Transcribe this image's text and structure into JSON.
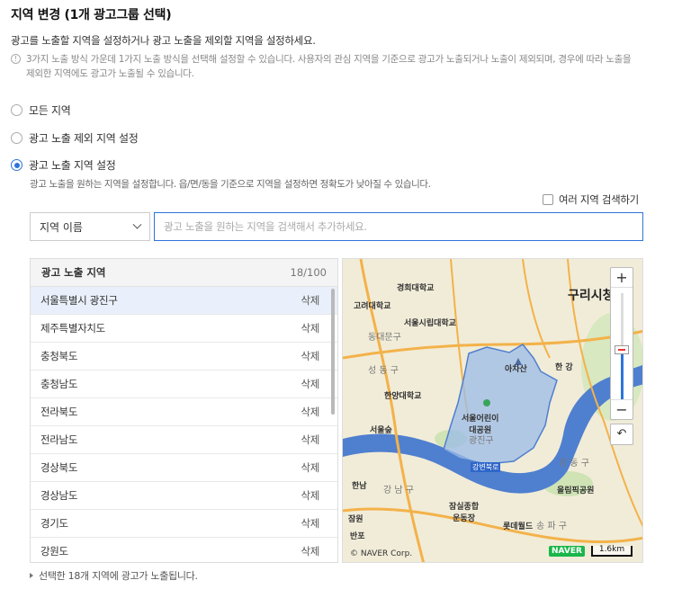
{
  "header": {
    "title": "지역 변경 (1개 광고그룹 선택)",
    "description": "광고를 노출할 지역을 설정하거나 광고 노출을 제외할 지역을 설정하세요.",
    "note_icon": "info-icon",
    "note": "3가지 노출 방식 가운데 1가지 노출 방식을 선택해 설정할 수 있습니다. 사용자의 관심 지역을 기준으로 광고가 노출되거나 노출이 제외되며, 경우에 따라 노출을 제외한 지역에도 광고가 노출될 수 있습니다."
  },
  "options": [
    {
      "label": "모든 지역",
      "selected": false
    },
    {
      "label": "광고 노출 제외 지역 설정",
      "selected": false
    },
    {
      "label": "광고 노출 지역 설정",
      "selected": true
    }
  ],
  "option_desc": "광고 노출을 원하는 지역을 설정합니다. 읍/면/동을 기준으로 지역을 설정하면 정확도가 낮아질 수 있습니다.",
  "multi_search": {
    "label": "여러 지역 검색하기",
    "checked": false
  },
  "search": {
    "type_value": "지역 이름",
    "placeholder": "광고 노출을 원하는 지역을 검색해서 추가하세요."
  },
  "region_list": {
    "header": "광고 노출 지역",
    "count": "18/100",
    "delete_label": "삭제",
    "items": [
      "서울특별시 광진구",
      "제주특별자치도",
      "충청북도",
      "충청남도",
      "전라북도",
      "전라남도",
      "경상북도",
      "경상남도",
      "경기도",
      "강원도"
    ]
  },
  "footer": "선택한 18개 지역에 광고가 노출됩니다.",
  "map": {
    "copyright": "© NAVER Corp.",
    "brand": "NAVER",
    "scale": "1.6km",
    "zoom_in": "+",
    "zoom_out": "−",
    "reset_icon": "undo-icon",
    "labels": {
      "guri": "구리시청",
      "hangang": "한 강",
      "gwangjin": "광진구",
      "children_park": "서울어린이\n대공원",
      "achasan": "아차산",
      "seongdong": "성 동 구",
      "dongdaemun": "동대문구",
      "gangdong": "강 동 구",
      "gangnam": "강 남 구",
      "songpa": "송 파 구",
      "hanyang": "한양대학교",
      "kyunghee": "경희대학교",
      "korea_univ": "고려대학교",
      "uos": "서울시립대학교",
      "seoulsup": "서울숲",
      "jamsil": "잠실종합\n운동장",
      "olympic": "올림픽공원",
      "lotte": "롯데월드",
      "gangbyeon": "강변북로",
      "hannam": "한남",
      "jamwon": "잠원",
      "banpo": "반포"
    },
    "colors": {
      "region_fill": "#9bbce8",
      "region_stroke": "#4f7fcf",
      "river": "#4f7fcf",
      "road": "#f3b24a",
      "land": "#f1ecd8"
    }
  }
}
